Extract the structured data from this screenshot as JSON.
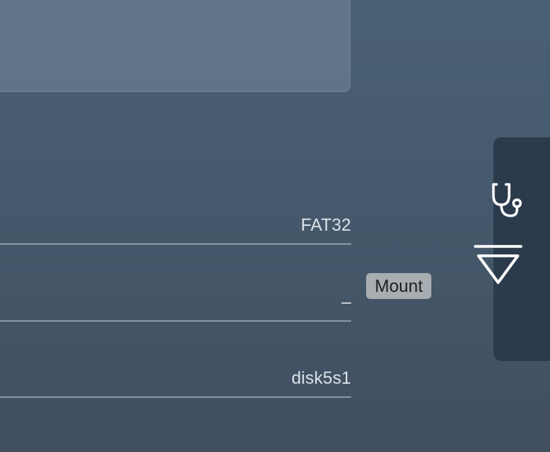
{
  "volume_info": {
    "rows": [
      {
        "value": "FAT32"
      },
      {
        "value": "–"
      },
      {
        "value": "disk5s1"
      }
    ]
  },
  "toolbar": {
    "first_aid_icon": "stethoscope-icon",
    "mount_icon": "mount-icon",
    "mount_tooltip": "Mount"
  },
  "colors": {
    "background_top": "#4a6075",
    "background_bottom": "#414f60",
    "sidebar": "#2b3b4c",
    "tooltip_bg": "#a8adb2",
    "icon": "#ffffff"
  }
}
